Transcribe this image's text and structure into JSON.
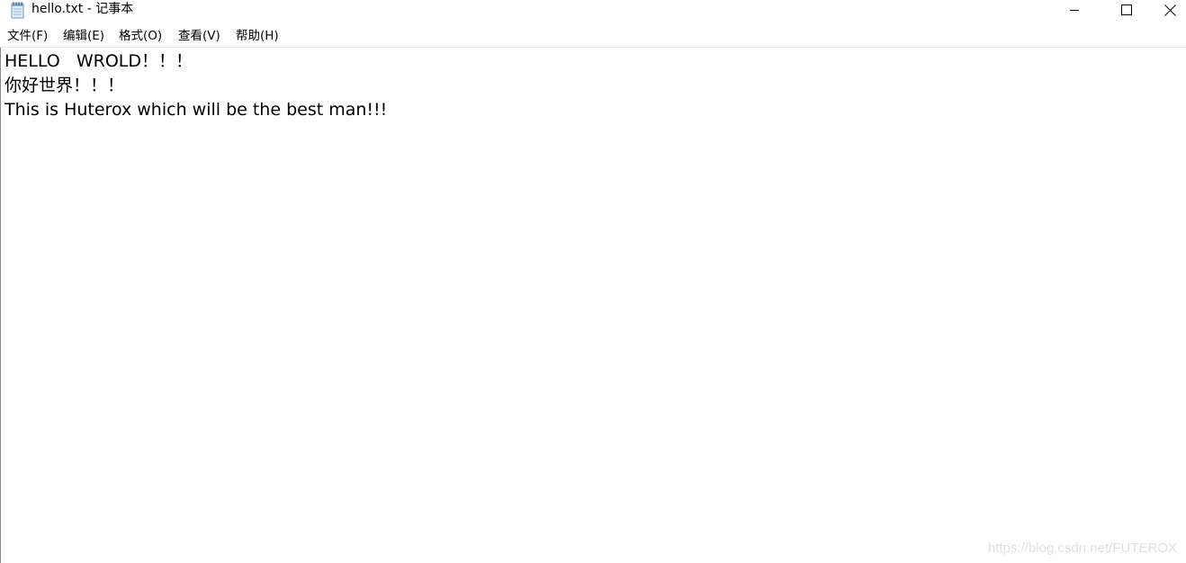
{
  "window": {
    "title": "hello.txt - 记事本",
    "icon": "notepad-icon"
  },
  "controls": {
    "minimize_icon": "minimize-icon",
    "maximize_icon": "maximize-icon",
    "close_icon": "close-icon"
  },
  "menu": {
    "items": [
      "文件(F)",
      "编辑(E)",
      "格式(O)",
      "查看(V)",
      "帮助(H)"
    ]
  },
  "document": {
    "lines": [
      "HELLO   WROLD！！！",
      "你好世界！！！",
      "This is Huterox which will be the best man!!!"
    ]
  },
  "watermark": "https://blog.csdn.net/FUTEROX"
}
